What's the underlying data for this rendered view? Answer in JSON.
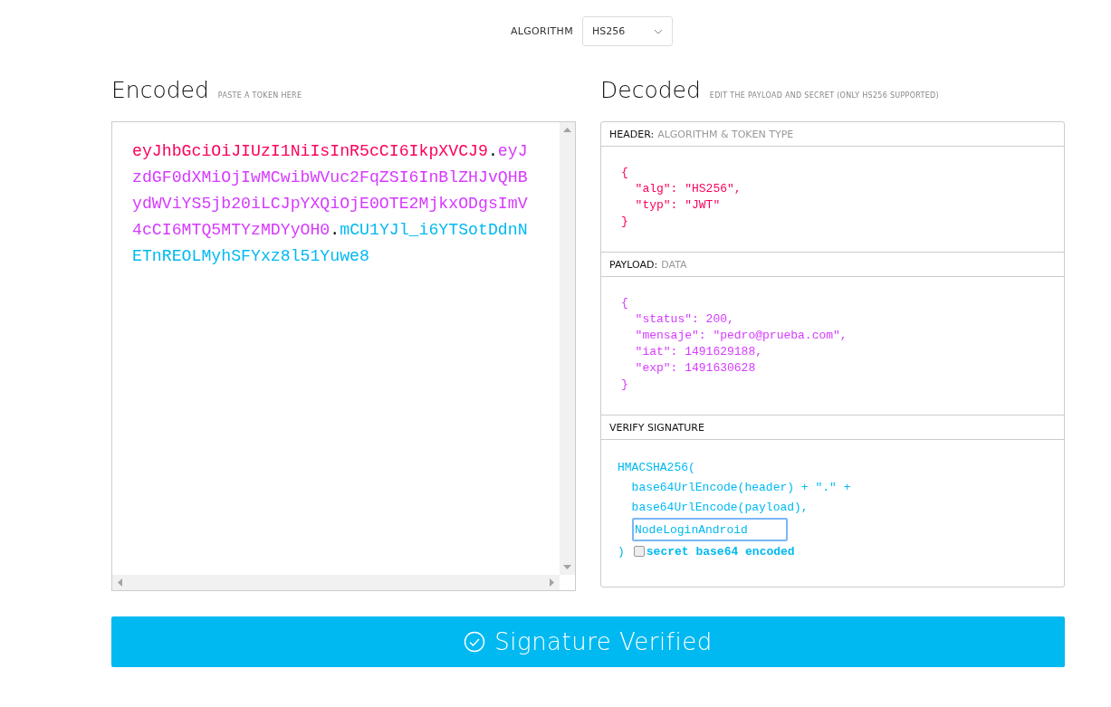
{
  "algorithm": {
    "label": "ALGORITHM",
    "value": "HS256"
  },
  "encoded": {
    "title": "Encoded",
    "subtitle": "PASTE A TOKEN HERE",
    "lines": [
      [
        {
          "kind": "header",
          "text": "eyJhbGciOiJIUzI1NiIsInR5cCI6IkpXVCJ9"
        },
        {
          "kind": "dot",
          "text": "."
        },
        {
          "kind": "payload",
          "text": "eyJ"
        }
      ],
      [
        {
          "kind": "payload",
          "text": "zdGF0dXMiOjIwMCwibWVuc2FqZSI6InBlZHJvQHB"
        }
      ],
      [
        {
          "kind": "payload",
          "text": "ydWViYS5jb20iLCJpYXQiOjE0OTE2MjkxODgsImV"
        }
      ],
      [
        {
          "kind": "payload",
          "text": "4cCI6MTQ5MTYzMDYyOH0"
        },
        {
          "kind": "dot",
          "text": "."
        },
        {
          "kind": "signature",
          "text": "mCU1YJl_i6YTSotDdnN"
        }
      ],
      [
        {
          "kind": "signature",
          "text": "ETnREOLMyhSFYxz8l51Yuwe8"
        }
      ]
    ]
  },
  "decoded": {
    "title": "Decoded",
    "subtitle": "EDIT THE PAYLOAD AND SECRET (ONLY HS256 SUPPORTED)",
    "header": {
      "label": "HEADER:",
      "hint": "ALGORITHM & TOKEN TYPE",
      "lines": [
        "{",
        "  \"alg\": \"HS256\",",
        "  \"typ\": \"JWT\"",
        "}"
      ]
    },
    "payload": {
      "label": "PAYLOAD:",
      "hint": "DATA",
      "lines": [
        "{",
        "  \"status\": 200,",
        "  \"mensaje\": \"pedro@prueba.com\",",
        "  \"iat\": 1491629188,",
        "  \"exp\": 1491630628",
        "}"
      ]
    },
    "signature": {
      "label": "VERIFY SIGNATURE",
      "lines": [
        "HMACSHA256(",
        "  base64UrlEncode(header) + \".\" +",
        "  base64UrlEncode(payload),"
      ],
      "secret": "NodeLoginAndroid",
      "close": ")",
      "checkbox_label": "secret base64 encoded",
      "checked": false
    }
  },
  "status_button": {
    "label": "Signature Verified"
  }
}
